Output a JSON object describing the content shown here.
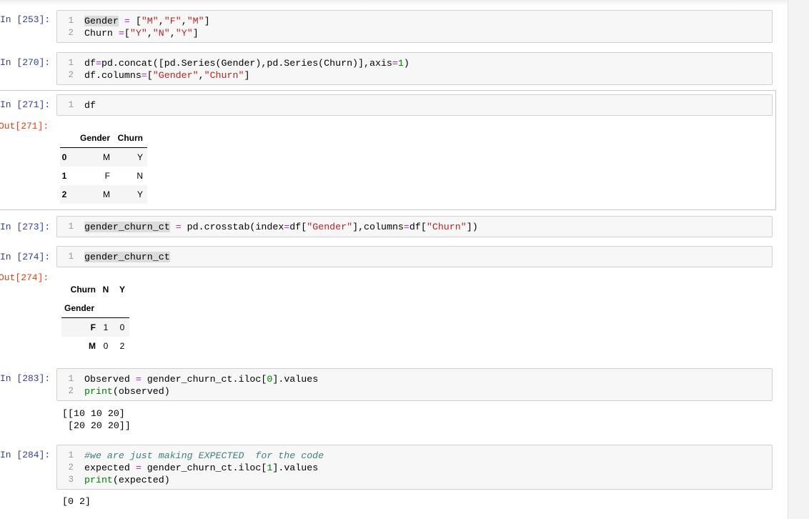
{
  "cells": {
    "c253": {
      "prompt": "In [253]:",
      "lines": [
        [
          "1",
          "Gender = [\"M\",\"F\",\"M\"]"
        ],
        [
          "2",
          "Churn =[\"Y\",\"N\",\"Y\"]"
        ]
      ]
    },
    "c270": {
      "prompt": "In [270]:",
      "lines": [
        [
          "1",
          "df=pd.concat([pd.Series(Gender),pd.Series(Churn)],axis=1)"
        ],
        [
          "2",
          "df.columns=[\"Gender\",\"Churn\"]"
        ]
      ]
    },
    "c271": {
      "prompt": "In [271]:",
      "out_prompt": "Out[271]:",
      "lines": [
        [
          "1",
          "df"
        ]
      ],
      "table": {
        "columns": [
          "Gender",
          "Churn"
        ],
        "rows": [
          {
            "index": "0",
            "values": [
              "M",
              "Y"
            ]
          },
          {
            "index": "1",
            "values": [
              "F",
              "N"
            ]
          },
          {
            "index": "2",
            "values": [
              "M",
              "Y"
            ]
          }
        ]
      }
    },
    "c273": {
      "prompt": "In [273]:",
      "lines": [
        [
          "1",
          "gender_churn_ct = pd.crosstab(index=df[\"Gender\"],columns=df[\"Churn\"])"
        ]
      ]
    },
    "c274": {
      "prompt": "In [274]:",
      "out_prompt": "Out[274]:",
      "lines": [
        [
          "1",
          "gender_churn_ct"
        ]
      ],
      "table": {
        "columns_name": "Churn",
        "columns": [
          "N",
          "Y"
        ],
        "index_name": "Gender",
        "rows": [
          {
            "index": "F",
            "values": [
              "1",
              "0"
            ]
          },
          {
            "index": "M",
            "values": [
              "0",
              "2"
            ]
          }
        ]
      }
    },
    "c283": {
      "prompt": "In [283]:",
      "lines": [
        [
          "1",
          "Observed = gender_churn_ct.iloc[0].values"
        ],
        [
          "2",
          "print(observed)"
        ]
      ],
      "output": "[[10 10 20]\n [20 20 20]]"
    },
    "c284": {
      "prompt": "In [284]:",
      "lines": [
        [
          "1",
          "#we are just making EXPECTED  for the code"
        ],
        [
          "2",
          "expected = gender_churn_ct.iloc[1].values"
        ],
        [
          "3",
          "print(expected)"
        ]
      ],
      "output": "[0 2]"
    }
  }
}
